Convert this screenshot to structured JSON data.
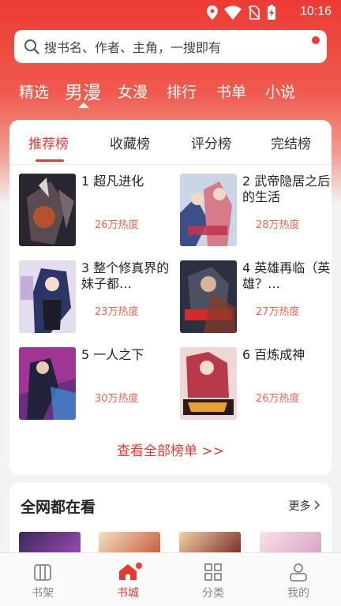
{
  "status_bar": {
    "time": "10:16"
  },
  "search": {
    "placeholder": "搜书名、作者、主角，一搜即有"
  },
  "nav": {
    "tabs": [
      {
        "label": "精选",
        "active": false
      },
      {
        "label": "男漫",
        "active": true
      },
      {
        "label": "女漫",
        "active": false
      },
      {
        "label": "排行",
        "active": false
      },
      {
        "label": "书单",
        "active": false
      },
      {
        "label": "小说",
        "active": false
      }
    ]
  },
  "ranking": {
    "tabs": [
      "推荐榜",
      "收藏榜",
      "评分榜",
      "完结榜"
    ],
    "active_tab": "推荐榜",
    "books": [
      {
        "rank": "1",
        "title": "超凡进化",
        "heat": "26万热度"
      },
      {
        "rank": "2",
        "title": "武帝隐居之后的生活",
        "heat": "28万热度"
      },
      {
        "rank": "3",
        "title": "整个修真界的妹子都…",
        "heat": "23万热度"
      },
      {
        "rank": "4",
        "title": "英雄再临（英雄？…",
        "heat": "27万热度"
      },
      {
        "rank": "5",
        "title": "一人之下",
        "heat": "30万热度"
      },
      {
        "rank": "6",
        "title": "百炼成神",
        "heat": "26万热度"
      }
    ],
    "view_all": "查看全部榜单 >>"
  },
  "trending": {
    "title": "全网都在看",
    "more": "更多"
  },
  "bottom_nav": {
    "tabs": [
      {
        "label": "书架",
        "icon": "bookshelf-icon"
      },
      {
        "label": "书城",
        "icon": "bookstore-icon",
        "active": true
      },
      {
        "label": "分类",
        "icon": "category-icon"
      },
      {
        "label": "我的",
        "icon": "profile-icon"
      }
    ]
  },
  "colors": {
    "brand": "#e53a33",
    "heat": "#e8684f"
  }
}
